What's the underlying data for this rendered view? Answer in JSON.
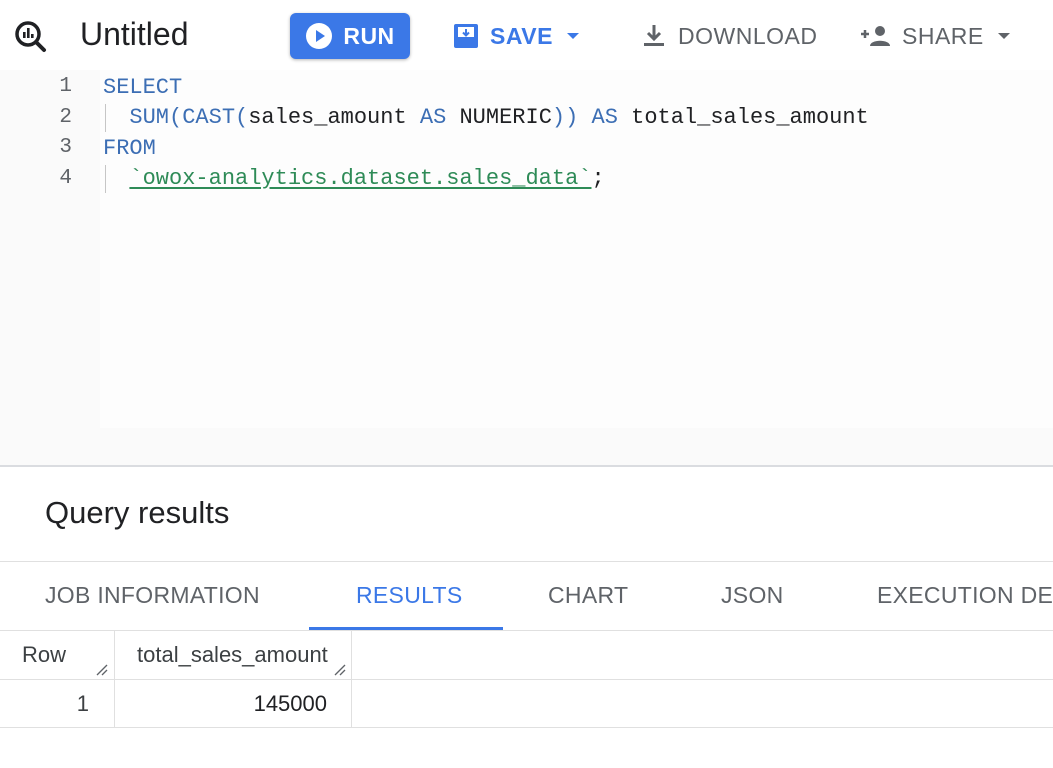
{
  "toolbar": {
    "title": "Untitled",
    "run_label": "RUN",
    "save_label": "SAVE",
    "download_label": "DOWNLOAD",
    "share_label": "SHARE",
    "icons": {
      "logo": "bigquery-logo-icon",
      "run": "play-circle-icon",
      "save": "save-icon",
      "save_menu": "arrow-drop-down-icon",
      "download": "download-icon",
      "share": "person-add-icon",
      "share_menu": "arrow-drop-down-icon"
    }
  },
  "editor": {
    "line_numbers": [
      "1",
      "2",
      "3",
      "4"
    ],
    "lines": {
      "l1": {
        "kw": "SELECT"
      },
      "l2": {
        "fn1": "SUM(CAST(",
        "col": "sales_amount ",
        "as1": "AS ",
        "type": "NUMERIC",
        "close": "))",
        "sp": " ",
        "as2": "AS",
        "alias": " total_sales_amount"
      },
      "l3": {
        "kw": "FROM"
      },
      "l4": {
        "table": "`owox-analytics.dataset.sales_data`",
        "end": ";"
      }
    }
  },
  "results": {
    "title": "Query results",
    "tabs": [
      "JOB INFORMATION",
      "RESULTS",
      "CHART",
      "JSON",
      "EXECUTION DET"
    ],
    "active_tab": "RESULTS",
    "columns": [
      "Row",
      "total_sales_amount"
    ],
    "rows": [
      [
        "1",
        "145000"
      ]
    ]
  },
  "colors": {
    "primary": "#3b78e7",
    "keyword": "#3c6eb4",
    "table_ref": "#2e8b57",
    "muted": "#5f6368"
  }
}
